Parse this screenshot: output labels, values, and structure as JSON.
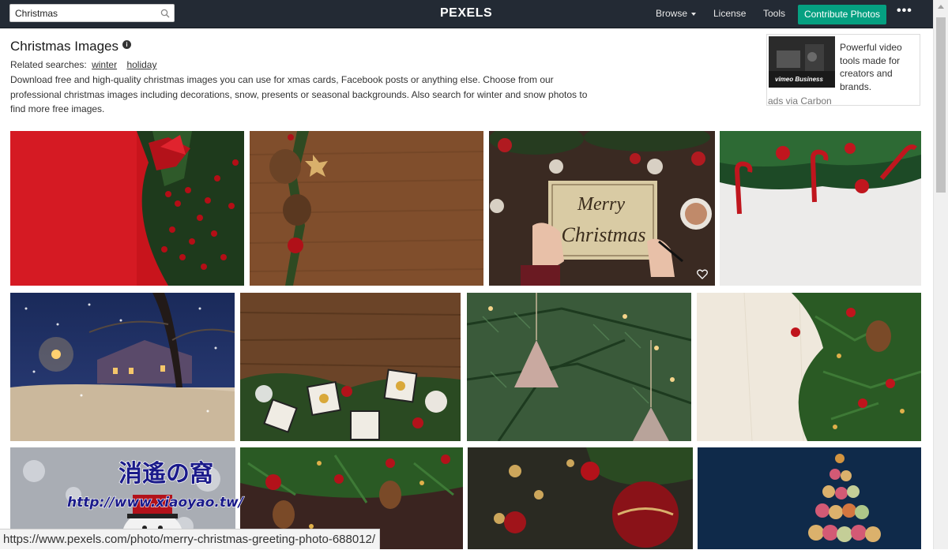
{
  "search": {
    "value": "Christmas",
    "placeholder": "",
    "icon": "search-icon"
  },
  "nav": {
    "logo": "PEXELS",
    "browse": "Browse",
    "license": "License",
    "tools": "Tools",
    "contribute": "Contribute Photos",
    "more": "•••"
  },
  "header": {
    "title": "Christmas Images",
    "related_label": "Related searches:",
    "related": [
      "winter",
      "holiday"
    ],
    "description": "Download free and high-quality christmas images you can use for xmas cards, Facebook posts or anything else. Choose from our professional christmas images including decorations, snow, presents or seasonal backgrounds. Also search for winter and snow photos to find more free images."
  },
  "ad": {
    "thumb_text": "vimeo Business",
    "text": "Powerful video tools made for creators and brands.",
    "via": "ads via Carbon"
  },
  "photos": [
    {
      "name": "photo-red-wreath"
    },
    {
      "name": "photo-pine-wood"
    },
    {
      "name": "photo-merry-christmas"
    },
    {
      "name": "photo-candy-cane"
    },
    {
      "name": "photo-snowy-house"
    },
    {
      "name": "photo-wood-ornaments"
    },
    {
      "name": "photo-wooden-tree-ornament"
    },
    {
      "name": "photo-fir-branches-white"
    },
    {
      "name": "photo-snowman"
    },
    {
      "name": "photo-red-ornaments-wood"
    },
    {
      "name": "photo-bauble-bokeh"
    },
    {
      "name": "photo-bokeh-tree"
    }
  ],
  "status_url": "https://www.pexels.com/photo/merry-christmas-greeting-photo-688012/",
  "watermark": "消遙の窩 http://www.xiaoyao.tw/",
  "colors": {
    "nav_bg": "#232a34",
    "contribute_bg": "#05a081"
  }
}
